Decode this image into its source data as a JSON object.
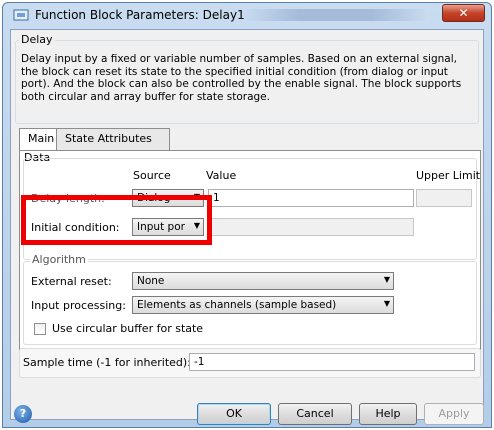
{
  "window": {
    "title": "Function Block Parameters: Delay1",
    "close_glyph": "✕"
  },
  "block": {
    "group_label": "Delay",
    "description": "Delay input by a fixed or variable number of samples. Based on an external signal, the block can reset its state to the specified initial condition (from dialog or input port). And the block can also be controlled by the enable signal. The block supports both circular and array buffer for state storage."
  },
  "tabs": [
    {
      "label": "Main",
      "active": true
    },
    {
      "label": "State Attributes",
      "active": false
    }
  ],
  "data_group": {
    "label": "Data",
    "col_source": "Source",
    "col_value": "Value",
    "col_upper": "Upper Limit",
    "delay_length": {
      "label": "Delay length:",
      "source": "Dialog",
      "value": "1"
    },
    "initial_condition": {
      "label": "Initial condition:",
      "source": "Input por",
      "value": ""
    }
  },
  "algorithm_group": {
    "label": "Algorithm",
    "external_reset": {
      "label": "External reset:",
      "value": "None"
    },
    "input_processing": {
      "label": "Input processing:",
      "value": "Elements as channels (sample based)"
    },
    "circular_buffer": {
      "label": "Use circular buffer for state",
      "checked": false
    }
  },
  "sample_time": {
    "label": "Sample time (-1 for inherited):",
    "value": "-1"
  },
  "buttons": {
    "ok": "OK",
    "cancel": "Cancel",
    "help": "Help",
    "apply": "Apply"
  },
  "help_icon_glyph": "?",
  "dropdown_arrow": "▼",
  "colors": {
    "highlight": "#ee0000",
    "title_bar": "#b3cde8"
  }
}
